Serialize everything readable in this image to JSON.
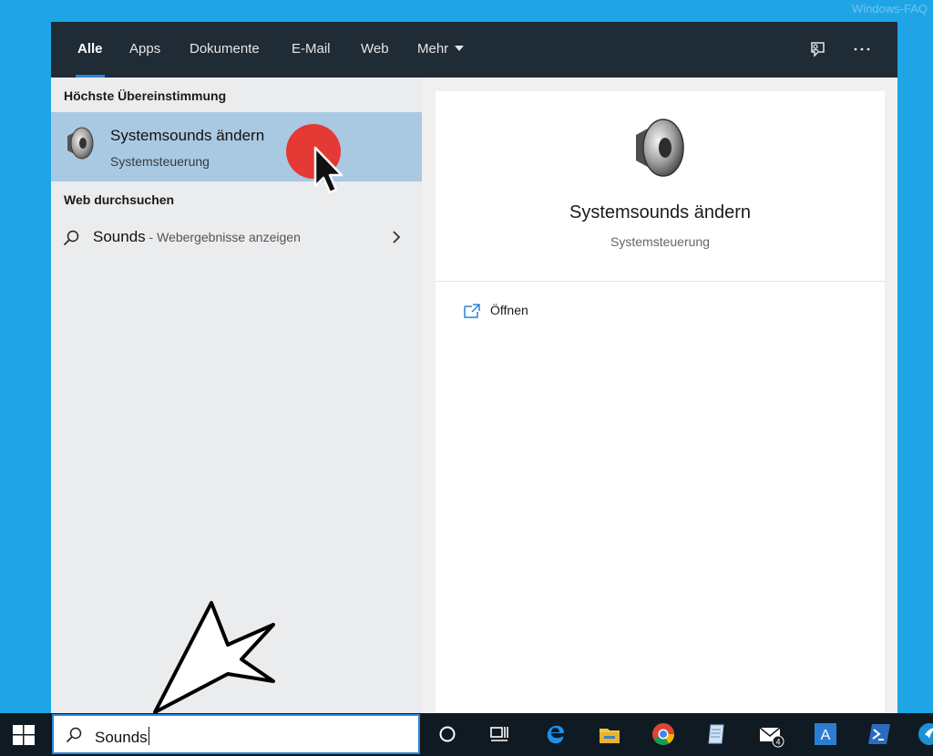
{
  "watermark": "Windows-FAQ",
  "colors": {
    "accent": "#2b84d8",
    "topbar": "#1f2b35",
    "selection": "#a9c9e3",
    "desktop": "#1fa5e6",
    "click_marker": "#e53935"
  },
  "tabs": [
    {
      "label": "Alle",
      "active": true
    },
    {
      "label": "Apps"
    },
    {
      "label": "Dokumente"
    },
    {
      "label": "E-Mail"
    },
    {
      "label": "Web"
    },
    {
      "label": "Mehr",
      "dropdown": true
    }
  ],
  "top_icons": [
    "feedback-icon",
    "more-options-icon"
  ],
  "sections": {
    "best_match_label": "Höchste Übereinstimmung",
    "web_label": "Web durchsuchen"
  },
  "best_match": {
    "title": "Systemsounds ändern",
    "subtitle": "Systemsteuerung",
    "icon": "speaker-icon"
  },
  "web_result": {
    "query": "Sounds",
    "hint": " - Webergebnisse anzeigen",
    "icon": "search-icon"
  },
  "detail": {
    "title": "Systemsounds ändern",
    "subtitle": "Systemsteuerung",
    "icon": "speaker-icon"
  },
  "actions": [
    {
      "label": "Öffnen",
      "icon": "open-icon"
    }
  ],
  "search": {
    "value": "Sounds"
  },
  "taskbar_icons": [
    "windows-start-icon",
    "cortana-icon",
    "task-view-icon",
    "edge-icon",
    "file-explorer-icon",
    "chrome-icon",
    "notepad-icon",
    "mail-icon",
    "word-icon",
    "powershell-icon",
    "app-icon"
  ],
  "mail_badge": "4"
}
